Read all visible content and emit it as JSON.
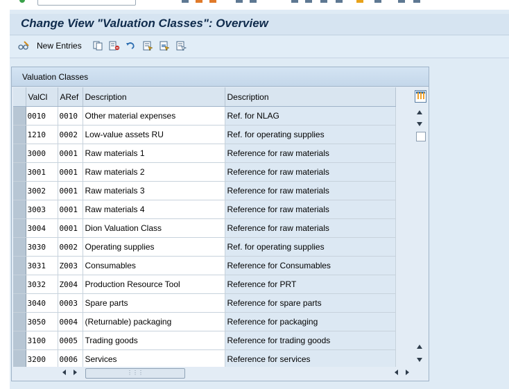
{
  "window": {
    "title": "Change View \"Valuation Classes\": Overview"
  },
  "toolbar": {
    "new_entries_label": "New Entries"
  },
  "table": {
    "frame_title": "Valuation Classes",
    "columns": [
      "ValCl",
      "ARef",
      "Description",
      "Description"
    ],
    "rows": [
      {
        "valcl": "0010",
        "aref": "0010",
        "desc": "Other material expenses",
        "refdesc": "Ref. for NLAG"
      },
      {
        "valcl": "1210",
        "aref": "0002",
        "desc": "Low-value assets RU",
        "refdesc": "Ref. for operating supplies"
      },
      {
        "valcl": "3000",
        "aref": "0001",
        "desc": "Raw materials 1",
        "refdesc": "Reference for raw materials"
      },
      {
        "valcl": "3001",
        "aref": "0001",
        "desc": "Raw materials 2",
        "refdesc": "Reference for raw materials"
      },
      {
        "valcl": "3002",
        "aref": "0001",
        "desc": "Raw materials 3",
        "refdesc": "Reference for raw materials"
      },
      {
        "valcl": "3003",
        "aref": "0001",
        "desc": "Raw materials 4",
        "refdesc": "Reference for raw materials"
      },
      {
        "valcl": "3004",
        "aref": "0001",
        "desc": "Dion Valuation Class",
        "refdesc": "Reference for raw materials"
      },
      {
        "valcl": "3030",
        "aref": "0002",
        "desc": "Operating supplies",
        "refdesc": "Ref. for operating supplies"
      },
      {
        "valcl": "3031",
        "aref": "Z003",
        "desc": "Consumables",
        "refdesc": "Reference for Consumables"
      },
      {
        "valcl": "3032",
        "aref": "Z004",
        "desc": "Production Resource Tool",
        "refdesc": "Reference for PRT"
      },
      {
        "valcl": "3040",
        "aref": "0003",
        "desc": "Spare parts",
        "refdesc": "Reference for spare parts"
      },
      {
        "valcl": "3050",
        "aref": "0004",
        "desc": "(Returnable) packaging",
        "refdesc": "Reference for packaging"
      },
      {
        "valcl": "3100",
        "aref": "0005",
        "desc": "Trading goods",
        "refdesc": "Reference for trading goods"
      },
      {
        "valcl": "3200",
        "aref": "0006",
        "desc": "Services",
        "refdesc": "Reference for services"
      }
    ]
  },
  "icons": {
    "new_entries": "pencil-glasses-icon",
    "copy_as": "copy-icon",
    "delete": "delete-icon",
    "undo": "undo-icon",
    "select_all": "select-all-icon",
    "select_block": "select-block-icon",
    "deselect_all": "deselect-all-icon",
    "column_settings": "table-settings-icon"
  },
  "colors": {
    "title_text": "#0f2b4c",
    "header_bg": "#d9e5f0",
    "ref_column_bg": "#dce8f3",
    "selector_bg": "#b7c6d4"
  }
}
